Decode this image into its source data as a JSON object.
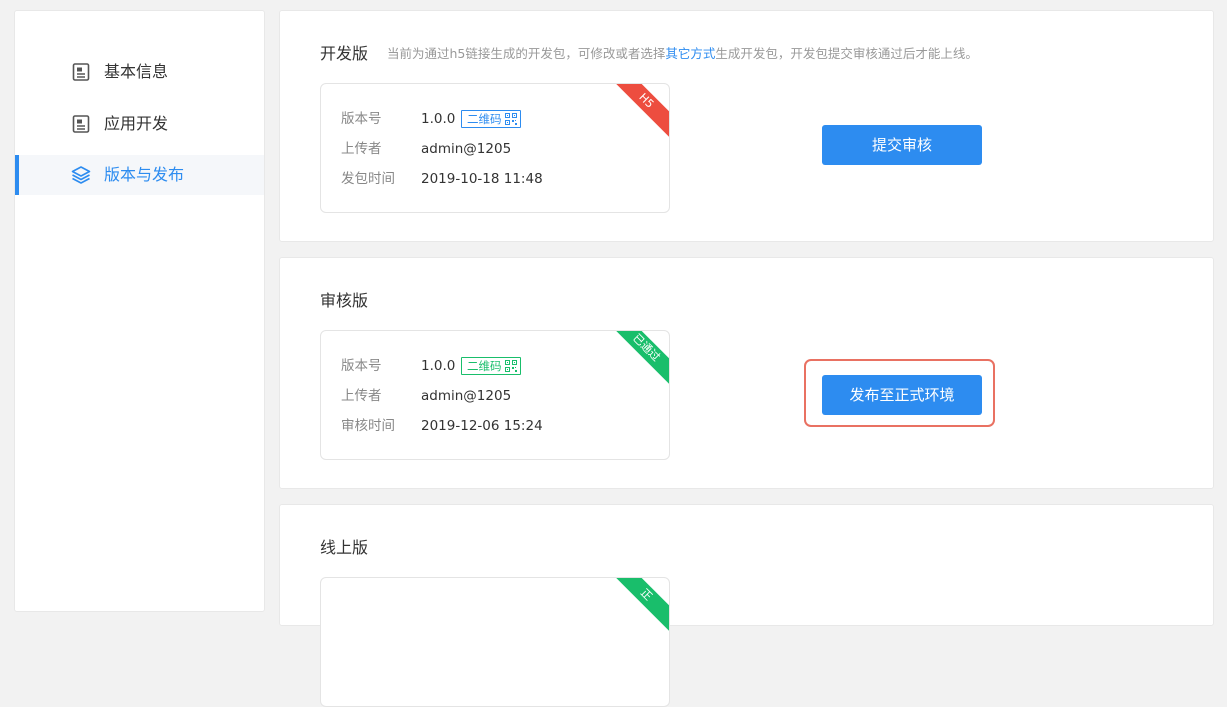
{
  "sidebar": {
    "items": [
      {
        "label": "基本信息",
        "icon": "document-icon"
      },
      {
        "label": "应用开发",
        "icon": "document-icon"
      },
      {
        "label": "版本与发布",
        "icon": "layers-icon"
      }
    ]
  },
  "dev": {
    "title": "开发版",
    "hint_pre": "当前为通过h5链接生成的开发包，可修改或者选择",
    "hint_link": "其它方式",
    "hint_post": "生成开发包，开发包提交审核通过后才能上线。",
    "ribbon": "H5",
    "version_label": "版本号",
    "version": "1.0.0",
    "qr_label": "二维码",
    "uploader_label": "上传者",
    "uploader": "admin@1205",
    "time_label": "发包时间",
    "time": "2019-10-18 11:48",
    "action": "提交审核"
  },
  "review": {
    "title": "审核版",
    "ribbon": "已通过",
    "version_label": "版本号",
    "version": "1.0.0",
    "qr_label": "二维码",
    "uploader_label": "上传者",
    "uploader": "admin@1205",
    "time_label": "审核时间",
    "time": "2019-12-06 15:24",
    "action": "发布至正式环境"
  },
  "online": {
    "title": "线上版",
    "ribbon": "正"
  },
  "colors": {
    "primary": "#2d8cf0",
    "success": "#19be6b",
    "danger": "#ed4d3f",
    "highlight": "#e97162"
  }
}
